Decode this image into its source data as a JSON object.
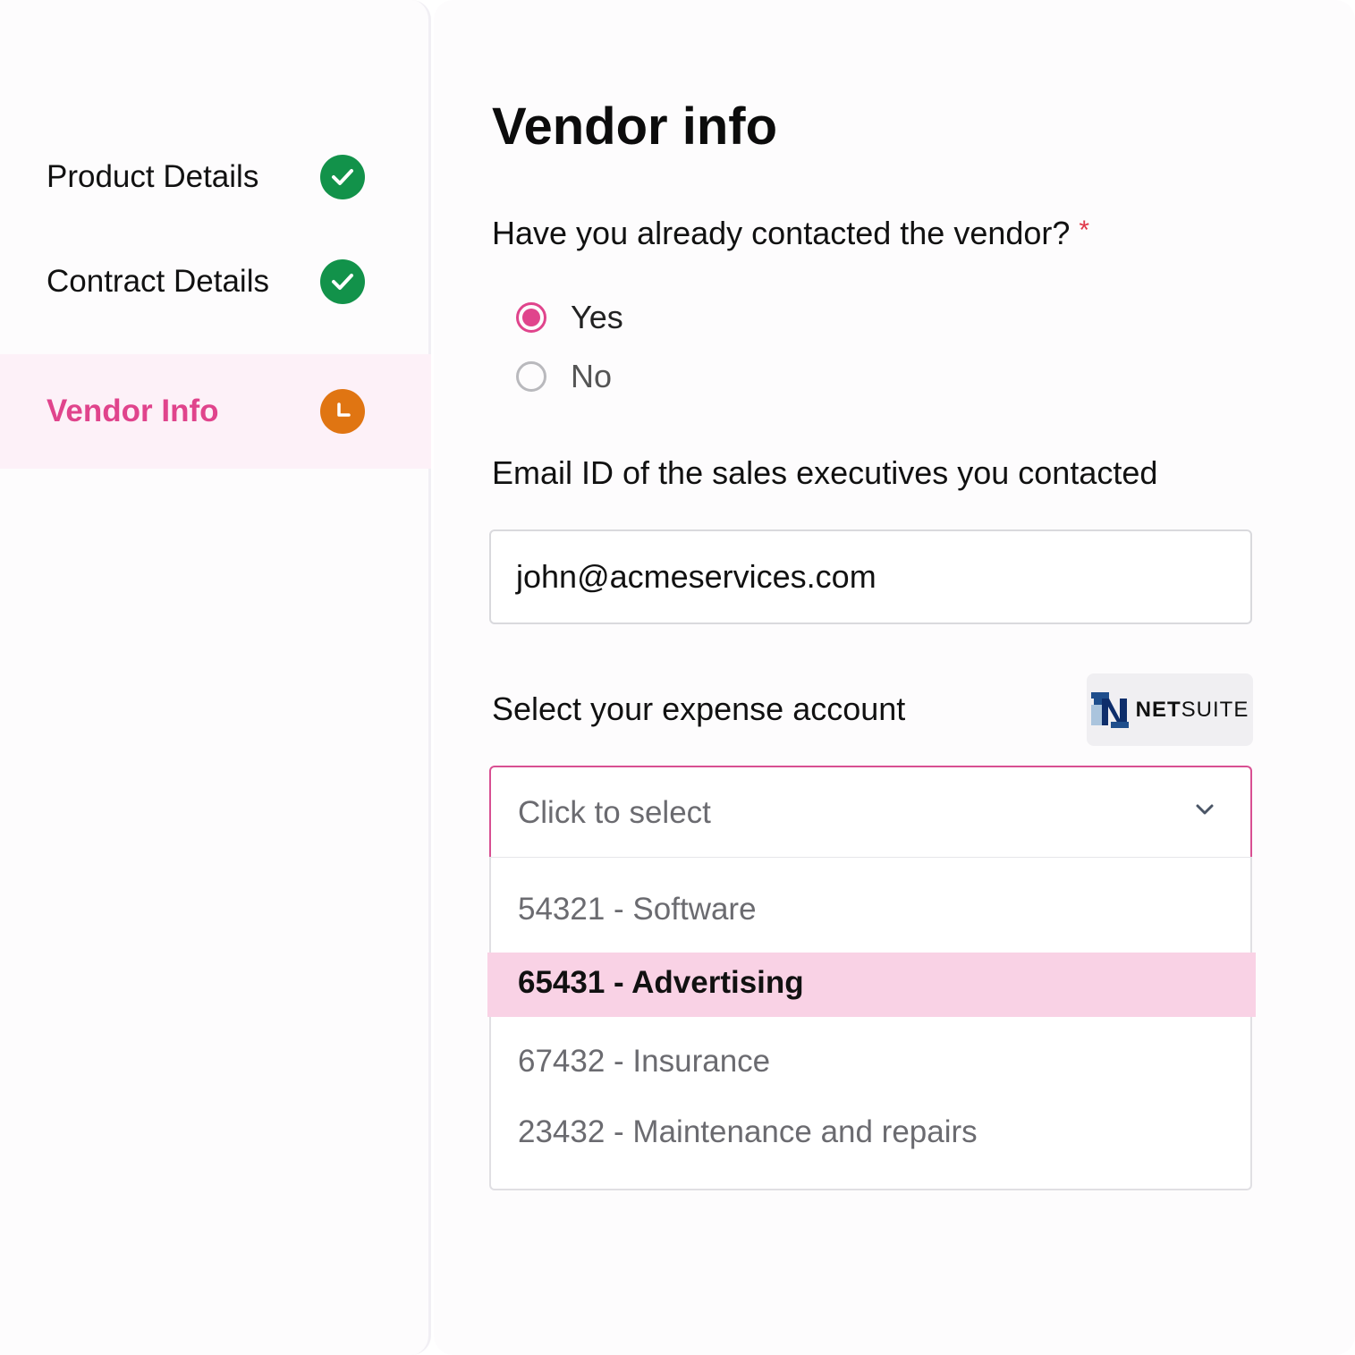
{
  "sidebar": {
    "steps": [
      {
        "label": "Product Details",
        "status": "done",
        "icon": "check-circle-icon"
      },
      {
        "label": "Contract Details",
        "status": "done",
        "icon": "check-circle-icon"
      },
      {
        "label": "Vendor Info",
        "status": "in-progress",
        "icon": "clock-icon"
      }
    ]
  },
  "main": {
    "title": "Vendor info",
    "contacted_question": "Have you already contacted the vendor?",
    "required_mark": "*",
    "radio_options": [
      {
        "label": "Yes",
        "selected": true
      },
      {
        "label": "No",
        "selected": false
      }
    ],
    "email_label": "Email ID of the sales executives you contacted",
    "email_value": "john@acmeservices.com",
    "expense_label": "Select your expense account",
    "integration": {
      "bold": "NET",
      "rest": "SUITE"
    },
    "select_placeholder": "Click to select",
    "options": [
      {
        "label": "54321 - Software",
        "highlighted": false
      },
      {
        "label": "65431 - Advertising",
        "highlighted": true
      },
      {
        "label": "67432 - Insurance",
        "highlighted": false
      },
      {
        "label": "23432 - Maintenance and repairs",
        "highlighted": false
      }
    ]
  },
  "colors": {
    "accent": "#e0448c",
    "done": "#12924a",
    "pending": "#e07512",
    "highlight": "#f9d2e5"
  }
}
